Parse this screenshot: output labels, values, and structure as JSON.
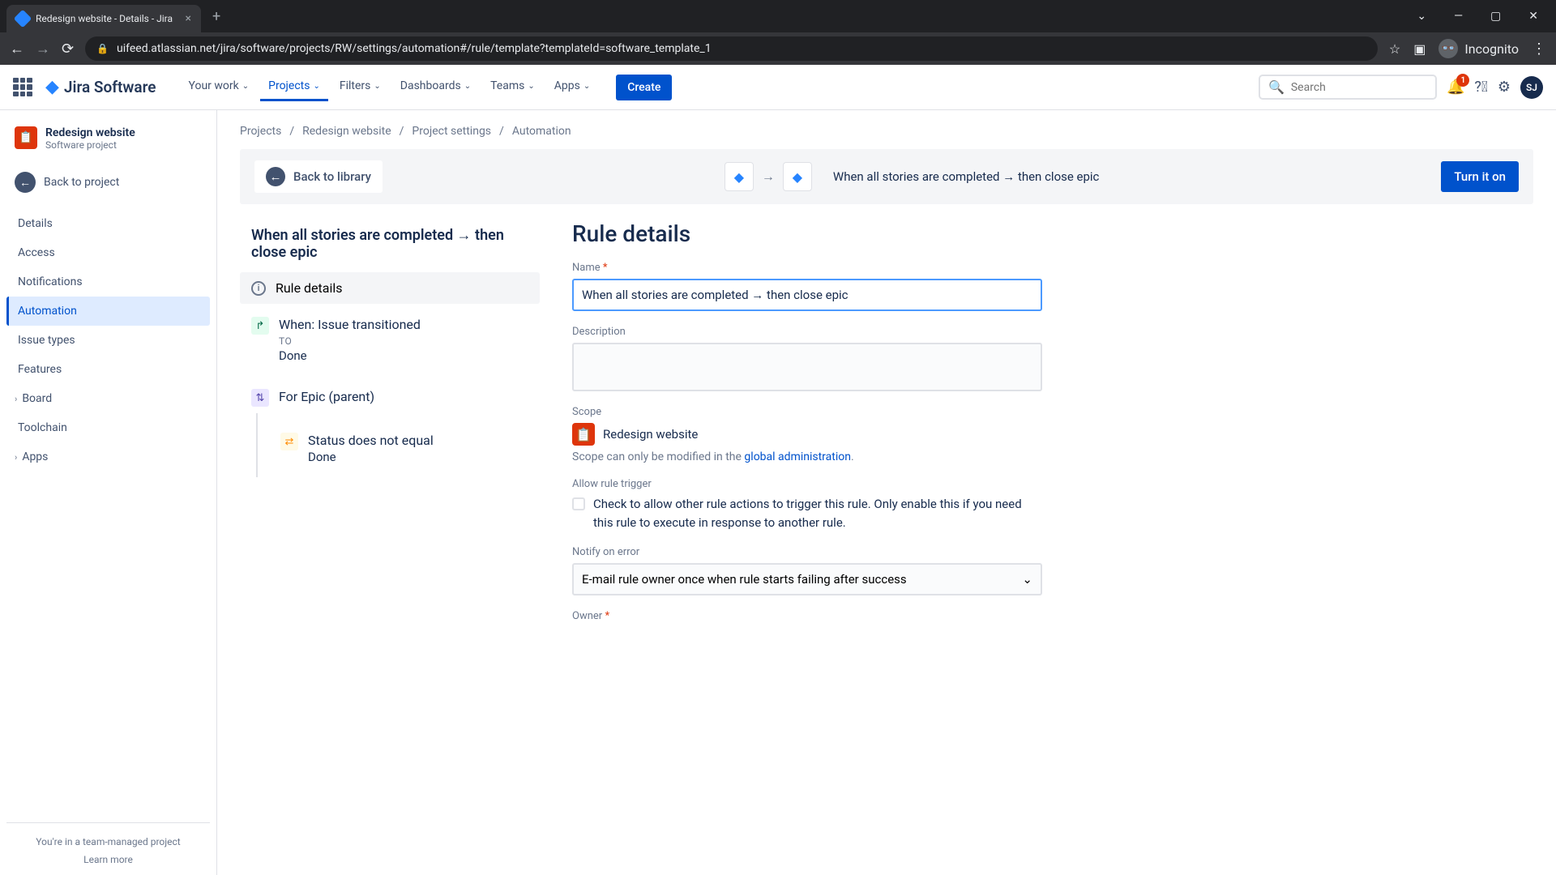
{
  "browser": {
    "tab_title": "Redesign website - Details - Jira",
    "url": "uifeed.atlassian.net/jira/software/projects/RW/settings/automation#/rule/template?templateId=software_template_1",
    "incognito_label": "Incognito"
  },
  "header": {
    "product": "Jira Software",
    "nav": [
      "Your work",
      "Projects",
      "Filters",
      "Dashboards",
      "Teams",
      "Apps"
    ],
    "active_nav_index": 1,
    "create": "Create",
    "search_placeholder": "Search",
    "notification_count": "1",
    "avatar_initials": "SJ"
  },
  "sidebar": {
    "project_name": "Redesign website",
    "project_type": "Software project",
    "back_to_project": "Back to project",
    "items": [
      "Details",
      "Access",
      "Notifications",
      "Automation",
      "Issue types",
      "Features",
      "Board",
      "Toolchain",
      "Apps"
    ],
    "active_index": 3,
    "expandable": {
      "6": true,
      "8": true
    },
    "footer_text": "You're in a team-managed project",
    "footer_link": "Learn more"
  },
  "breadcrumbs": [
    "Projects",
    "Redesign website",
    "Project settings",
    "Automation"
  ],
  "header_bar": {
    "back": "Back to library",
    "summary": "When all stories are completed → then close epic",
    "turn_on": "Turn it on"
  },
  "rule_tree": {
    "title": "When all stories are completed → then close epic",
    "details_label": "Rule details",
    "steps": [
      {
        "icon": "green",
        "glyph": "↱",
        "title": "When: Issue transitioned",
        "sub": "TO",
        "val": "Done"
      },
      {
        "icon": "purple",
        "glyph": "⇅",
        "title": "For Epic (parent)",
        "sub": "",
        "val": ""
      },
      {
        "icon": "yellow",
        "glyph": "⇄",
        "title": "Status does not equal",
        "sub": "",
        "val": "Done",
        "indent": true
      }
    ]
  },
  "details_form": {
    "heading": "Rule details",
    "name_label": "Name",
    "name_value": "When all stories are completed → then close epic",
    "desc_label": "Description",
    "scope_label": "Scope",
    "scope_value": "Redesign website",
    "scope_note_prefix": "Scope can only be modified in the ",
    "scope_note_link": "global administration",
    "allow_label": "Allow rule trigger",
    "allow_text": "Check to allow other rule actions to trigger this rule. Only enable this if you need this rule to execute in response to another rule.",
    "notify_label": "Notify on error",
    "notify_value": "E-mail rule owner once when rule starts failing after success",
    "owner_label": "Owner"
  }
}
